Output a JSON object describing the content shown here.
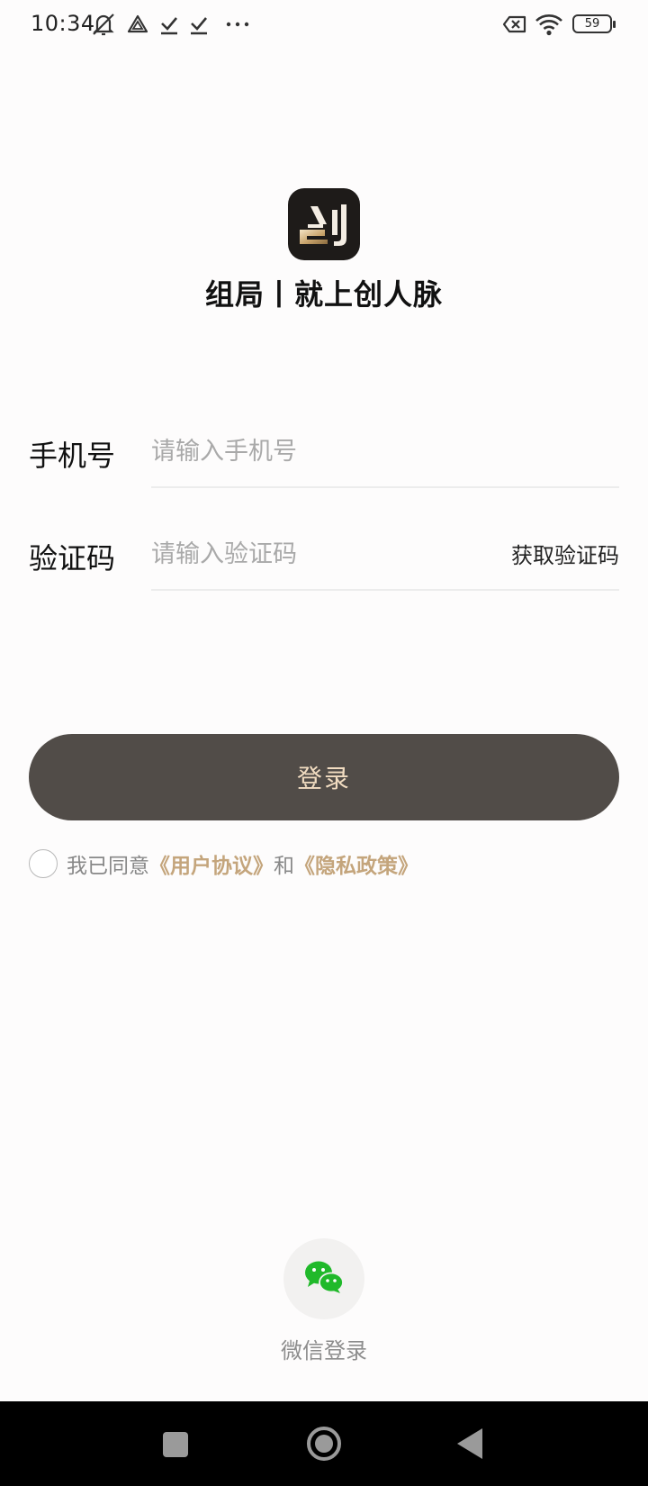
{
  "status_bar": {
    "time": "10:34",
    "battery": "59",
    "icons": [
      "bell-off-icon",
      "triangle-app-icon",
      "check-icon",
      "check-icon",
      "more-dots-icon",
      "no-sim-icon",
      "wifi-icon",
      "battery-icon"
    ]
  },
  "brand": {
    "logo_icon": "app-logo-icon",
    "slogan": "组局丨就上创人脉"
  },
  "form": {
    "phone": {
      "label": "手机号",
      "value": "",
      "placeholder": "请输入手机号"
    },
    "code": {
      "label": "验证码",
      "value": "",
      "placeholder": "请输入验证码",
      "get_code_label": "获取验证码"
    }
  },
  "login_button": "登录",
  "agreement": {
    "checked": false,
    "prefix": "我已同意",
    "user_agreement": "《用户协议》",
    "conjunction": "和",
    "privacy_policy": "《隐私政策》"
  },
  "wechat_login": {
    "icon": "wechat-icon",
    "label": "微信登录"
  },
  "nav_bar": {
    "icons": [
      "recent-apps-icon",
      "home-icon",
      "back-icon"
    ]
  },
  "colors": {
    "background": "#fdfcfc",
    "button": "#514c48",
    "button_text": "#f1dcc1",
    "link": "#c4a57c",
    "wechat_green": "#20b92a"
  }
}
